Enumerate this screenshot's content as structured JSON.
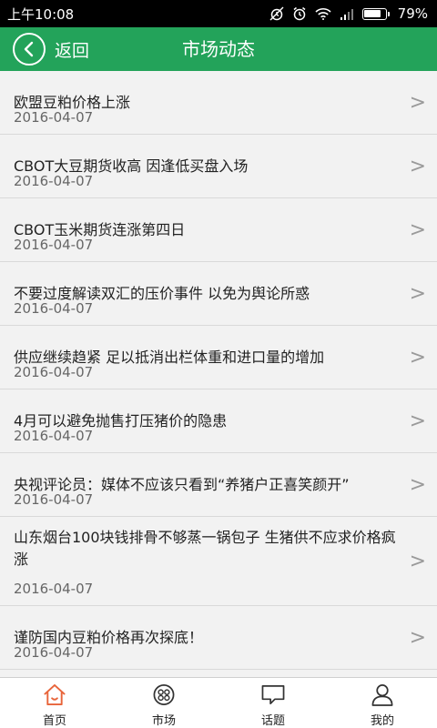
{
  "status": {
    "time": "上午10:08",
    "battery_level": "79%"
  },
  "header": {
    "back_label": "返回",
    "title": "市场动态"
  },
  "news": [
    {
      "title": "欧盟豆粕价格上涨",
      "date": "2016-04-07"
    },
    {
      "title": "CBOT大豆期货收高 因逢低买盘入场",
      "date": "2016-04-07"
    },
    {
      "title": "CBOT玉米期货连涨第四日",
      "date": "2016-04-07"
    },
    {
      "title": "不要过度解读双汇的压价事件 以免为舆论所惑",
      "date": "2016-04-07"
    },
    {
      "title": "供应继续趋紧 足以抵消出栏体重和进口量的增加",
      "date": "2016-04-07"
    },
    {
      "title": "4月可以避免抛售打压猪价的隐患",
      "date": "2016-04-07"
    },
    {
      "title": "央视评论员：媒体不应该只看到“养猪户正喜笑颜开”",
      "date": "2016-04-07"
    },
    {
      "title": "山东烟台100块钱排骨不够蒸一锅包子 生猪供不应求价格疯涨",
      "date": "2016-04-07"
    },
    {
      "title": "谨防国内豆粕价格再次探底！",
      "date": "2016-04-07"
    }
  ],
  "arrow_glyph": ">",
  "tabs": [
    {
      "label": "首页",
      "icon": "home-icon"
    },
    {
      "label": "市场",
      "icon": "market-icon"
    },
    {
      "label": "话题",
      "icon": "topic-icon"
    },
    {
      "label": "我的",
      "icon": "profile-icon"
    }
  ],
  "colors": {
    "accent": "#23a35a",
    "active_tab_icon": "#e8643a"
  }
}
